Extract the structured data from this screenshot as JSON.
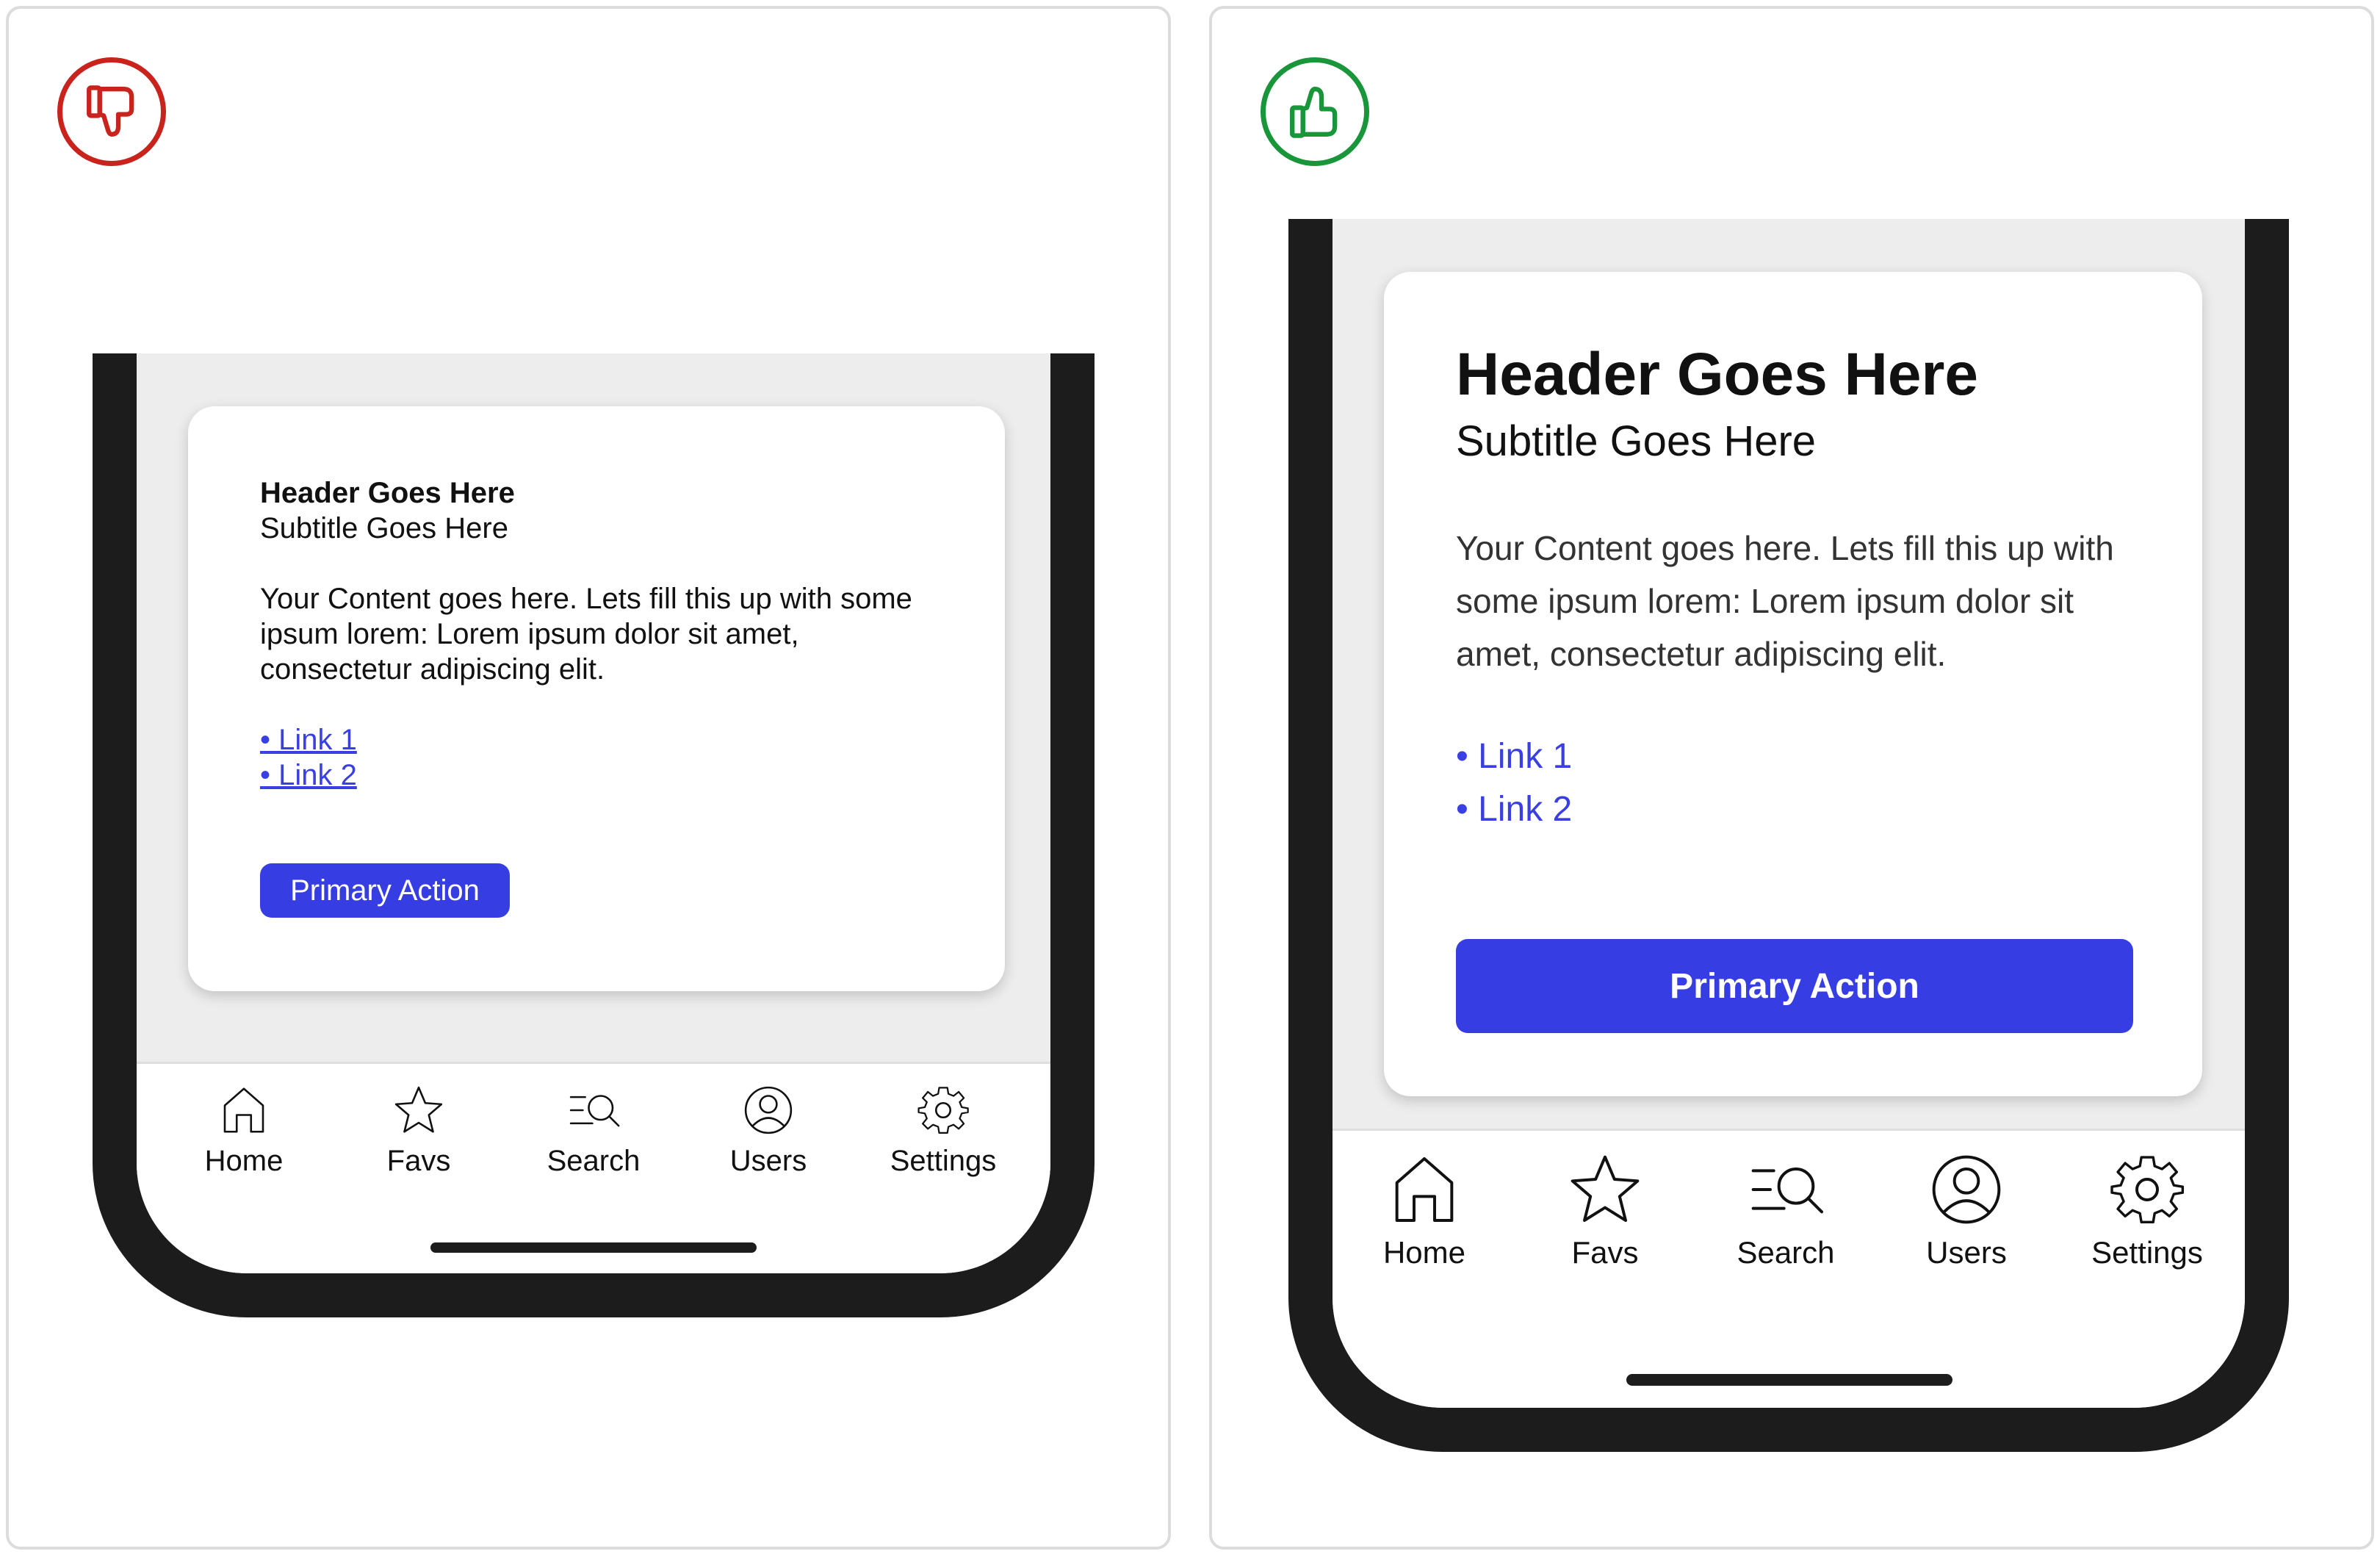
{
  "colors": {
    "bad_accent": "#c8231d",
    "good_accent": "#19963a",
    "button": "#363ee3",
    "link": "#3a3fe4",
    "phone_frame": "#1c1c1c"
  },
  "bad": {
    "verdict_icon": "thumbs-down-icon",
    "card": {
      "title": "Header Goes Here",
      "subtitle": "Subtitle Goes Here",
      "body": "Your Content goes here. Lets fill this up with some ipsum lorem: Lorem ipsum dolor sit amet, consectetur adipiscing elit.",
      "links": [
        "• Link 1",
        "• Link 2"
      ],
      "primary_action": "Primary Action"
    },
    "nav": [
      {
        "label": "Home",
        "icon": "home-icon"
      },
      {
        "label": "Favs",
        "icon": "star-icon"
      },
      {
        "label": "Search",
        "icon": "search-icon"
      },
      {
        "label": "Users",
        "icon": "user-icon"
      },
      {
        "label": "Settings",
        "icon": "gear-icon"
      }
    ]
  },
  "good": {
    "verdict_icon": "thumbs-up-icon",
    "card": {
      "title": "Header Goes Here",
      "subtitle": "Subtitle Goes Here",
      "body": "Your Content goes here. Lets fill this up with some ipsum lorem: Lorem ipsum dolor sit amet, consectetur adipiscing elit.",
      "links": [
        "• Link 1",
        "• Link 2"
      ],
      "primary_action": "Primary Action"
    },
    "nav": [
      {
        "label": "Home",
        "icon": "home-icon"
      },
      {
        "label": "Favs",
        "icon": "star-icon"
      },
      {
        "label": "Search",
        "icon": "search-icon"
      },
      {
        "label": "Users",
        "icon": "user-icon"
      },
      {
        "label": "Settings",
        "icon": "gear-icon"
      }
    ]
  }
}
